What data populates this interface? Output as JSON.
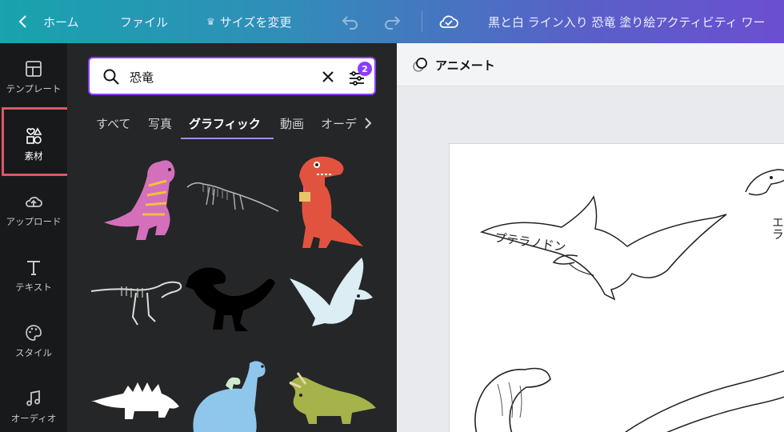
{
  "topbar": {
    "home_label": "ホーム",
    "file_label": "ファイル",
    "resize_label": "サイズを変更",
    "doc_title": "黒と白 ライン入り 恐竜 塗り絵アクティビティ ワー"
  },
  "rail": {
    "items": [
      {
        "label": "テンプレート",
        "icon": "template-icon"
      },
      {
        "label": "素材",
        "icon": "elements-icon"
      },
      {
        "label": "アップロード",
        "icon": "upload-icon"
      },
      {
        "label": "テキスト",
        "icon": "text-icon"
      },
      {
        "label": "スタイル",
        "icon": "palette-icon"
      },
      {
        "label": "オーディオ",
        "icon": "music-icon"
      }
    ]
  },
  "search": {
    "value": "恐竜",
    "filter_count": "2"
  },
  "tabs": [
    "すべて",
    "写真",
    "グラフィック",
    "動画",
    "オーデ"
  ],
  "grid_items": [
    "pink-dinosaur",
    "dinosaur-skeleton",
    "red-trex-with-cake",
    "trex-skeleton",
    "black-trex-silhouette",
    "pterodactyl",
    "white-stegosaurus",
    "blue-brachiosaurus",
    "triceratops"
  ],
  "canvas": {
    "toolbar_label": "アニメート",
    "labels": {
      "pteranodon": "プテラノドン",
      "side": "エラ"
    }
  },
  "colors": {
    "accent": "#8b3dff",
    "highlight": "#e05567"
  }
}
